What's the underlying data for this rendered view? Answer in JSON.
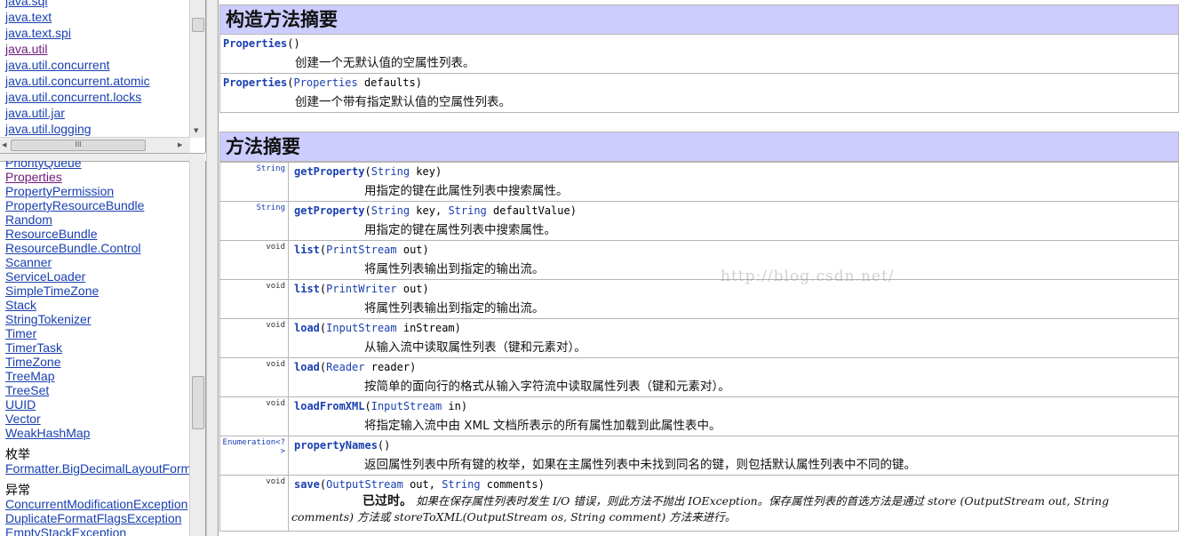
{
  "packages": [
    "java.sql",
    "java.text",
    "java.text.spi",
    "java.util",
    "java.util.concurrent",
    "java.util.concurrent.atomic",
    "java.util.concurrent.locks",
    "java.util.jar",
    "java.util.logging"
  ],
  "hscroll_label": "III",
  "classes": [
    "PriorityQueue",
    "Properties",
    "PropertyPermission",
    "PropertyResourceBundle",
    "Random",
    "ResourceBundle",
    "ResourceBundle.Control",
    "Scanner",
    "ServiceLoader",
    "SimpleTimeZone",
    "Stack",
    "StringTokenizer",
    "Timer",
    "TimerTask",
    "TimeZone",
    "TreeMap",
    "TreeSet",
    "UUID",
    "Vector",
    "WeakHashMap"
  ],
  "enum_heading": "枚举",
  "enums": [
    "Formatter.BigDecimalLayoutForm"
  ],
  "exception_heading": "异常",
  "exceptions": [
    "ConcurrentModificationException",
    "DuplicateFormatFlagsException",
    "EmptyStackException"
  ],
  "constructor_summary": {
    "title": "构造方法摘要",
    "rows": [
      {
        "name": "Properties",
        "params_pre": "()",
        "param_type": "",
        "params_post": "",
        "desc": "创建一个无默认值的空属性列表。"
      },
      {
        "name": "Properties",
        "params_pre": "(",
        "param_type": "Properties",
        "params_post": " defaults)",
        "desc": "创建一个带有指定默认值的空属性列表。"
      }
    ]
  },
  "method_summary": {
    "title": "方法摘要",
    "rows": [
      {
        "ret": "String",
        "ret_link": true,
        "name": "getProperty",
        "sig": "(<a>String</a> key)",
        "desc": "用指定的键在此属性列表中搜索属性。"
      },
      {
        "ret": "String",
        "ret_link": true,
        "name": "getProperty",
        "sig": "(<a>String</a> key, <a>String</a> defaultValue)",
        "desc": "用指定的键在属性列表中搜索属性。"
      },
      {
        "ret": "void",
        "ret_link": false,
        "name": "list",
        "sig": "(<a>PrintStream</a> out)",
        "desc": "将属性列表输出到指定的输出流。"
      },
      {
        "ret": "void",
        "ret_link": false,
        "name": "list",
        "sig": "(<a>PrintWriter</a> out)",
        "desc": "将属性列表输出到指定的输出流。"
      },
      {
        "ret": "void",
        "ret_link": false,
        "name": "load",
        "sig": "(<a>InputStream</a> inStream)",
        "desc": "从输入流中读取属性列表（键和元素对）。"
      },
      {
        "ret": "void",
        "ret_link": false,
        "name": "load",
        "sig": "(<a>Reader</a> reader)",
        "desc": "按简单的面向行的格式从输入字符流中读取属性列表（键和元素对）。"
      },
      {
        "ret": "void",
        "ret_link": false,
        "name": "loadFromXML",
        "sig": "(<a>InputStream</a> in)",
        "desc": "将指定输入流中由 XML 文档所表示的所有属性加载到此属性表中。"
      },
      {
        "ret": "Enumeration<?>",
        "ret_link": true,
        "name": "propertyNames",
        "sig": "()",
        "desc": "返回属性列表中所有键的枚举，如果在主属性列表中未找到同名的键，则包括默认属性列表中不同的键。"
      }
    ],
    "save_row": {
      "ret": "void",
      "name": "save",
      "sig": "(<a>OutputStream</a> out, <a>String</a> comments)",
      "deprecated_label": "已过时。",
      "deprecated_text": "如果在保存属性列表时发生 I/O 错误，则此方法不抛出 IOException。保存属性列表的首选方法是通过 store (OutputStream out, String comments) 方法或 storeToXML(OutputStream os, String comment) 方法来进行。"
    }
  },
  "watermark": "http://blog.csdn.net/"
}
